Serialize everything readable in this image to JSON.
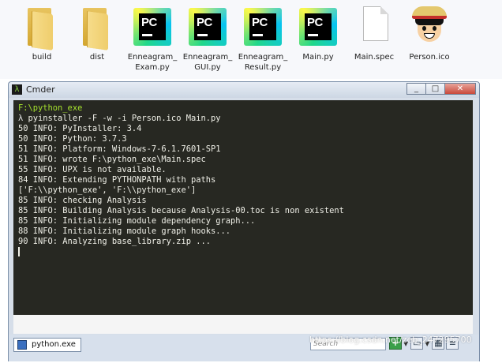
{
  "desktop": {
    "files": [
      {
        "label": "build",
        "type": "folder"
      },
      {
        "label": "dist",
        "type": "folder"
      },
      {
        "label": "Enneagram_\nExam.py",
        "type": "pycharm"
      },
      {
        "label": "Enneagram_\nGUI.py",
        "type": "pycharm"
      },
      {
        "label": "Enneagram_\nResult.py",
        "type": "pycharm"
      },
      {
        "label": "Main.py",
        "type": "pycharm"
      },
      {
        "label": "Main.spec",
        "type": "document"
      },
      {
        "label": "Person.ico",
        "type": "luffy-image"
      }
    ],
    "pycharm_badge": "PC"
  },
  "window": {
    "title": "Cmder",
    "icon_glyph": "λ",
    "buttons": {
      "minimize": "_",
      "maximize": "□",
      "close": "✕"
    }
  },
  "console": {
    "prompt_path": "F:\\python_exe",
    "prompt_symbol": "λ",
    "command": " pyinstaller -F -w -i Person.ico Main.py",
    "lines": [
      "50 INFO: PyInstaller: 3.4",
      "50 INFO: Python: 3.7.3",
      "51 INFO: Platform: Windows-7-6.1.7601-SP1",
      "51 INFO: wrote F:\\python_exe\\Main.spec",
      "55 INFO: UPX is not available.",
      "84 INFO: Extending PYTHONPATH with paths",
      "['F:\\\\python_exe', 'F:\\\\python_exe']",
      "85 INFO: checking Analysis",
      "85 INFO: Building Analysis because Analysis-00.toc is non existent",
      "85 INFO: Initializing module dependency graph...",
      "88 INFO: Initializing module graph hooks...",
      "90 INFO: Analyzing base_library.zip ..."
    ]
  },
  "statusbar": {
    "tab_label": "python.exe",
    "search_placeholder": "Search",
    "add_button": "+",
    "watermark": "https://blog.csdn.net/zeb_247295700"
  },
  "colors": {
    "console_bg": "#272822",
    "console_fg": "#f0f0e8",
    "path_green": "#a6e22e",
    "window_frame": "#d6dee9"
  }
}
